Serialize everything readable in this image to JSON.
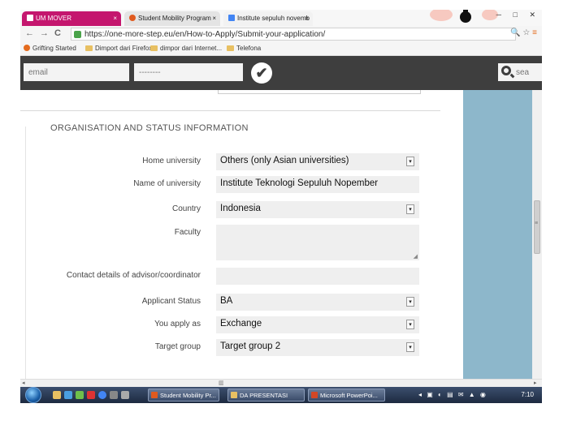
{
  "browser": {
    "tabs": [
      {
        "label": "UM MOVER",
        "favicon_color": "#c4166e"
      },
      {
        "label": "Student Mobility Program",
        "favicon_color": "#e05a1e"
      },
      {
        "label": "Institute sepuluh novemb",
        "favicon_color": "#4285f4"
      }
    ],
    "tab_close": "×",
    "window_controls": "─ □ ✕",
    "nav": {
      "back": "←",
      "forward": "→",
      "reload": "C",
      "zoom": "🔍",
      "star": "☆",
      "menu": "≡"
    },
    "url": "https://one-more-step.eu/en/How-to-Apply/Submit-your-application/",
    "bookmarks": [
      {
        "label": "Grifting Started",
        "icon": "firefox-icon"
      },
      {
        "label": "Dimport dari Firefox",
        "icon": "folder-icon"
      },
      {
        "label": "dimpor dari Internet...",
        "icon": "folder-icon"
      },
      {
        "label": "Telefona",
        "icon": "folder-icon"
      }
    ]
  },
  "site_header": {
    "email_placeholder": "email",
    "password_placeholder": "--------",
    "submit_symbol": "✔",
    "search_placeholder": "sea"
  },
  "form": {
    "section_title": "ORGANISATION AND STATUS INFORMATION",
    "fields": [
      {
        "label": "Home university",
        "value": "Others (only Asian universities)",
        "type": "select"
      },
      {
        "label": "Name of university",
        "value": "Institute Teknologi Sepuluh Nopember",
        "type": "text"
      },
      {
        "label": "Country",
        "value": "Indonesia",
        "type": "select"
      },
      {
        "label": "Faculty",
        "value": "",
        "type": "textarea"
      },
      {
        "label": "Contact details of advisor/coordinator",
        "value": "",
        "type": "text"
      },
      {
        "label": "Applicant Status",
        "value": "BA",
        "type": "select"
      },
      {
        "label": "You apply as",
        "value": "Exchange",
        "type": "select"
      },
      {
        "label": "Target group",
        "value": "Target group 2",
        "type": "select"
      }
    ],
    "select_arrow": "▾",
    "resize_grip": "◢"
  },
  "scrollbar": {
    "left_arrow": "◂",
    "right_arrow": "▸",
    "grip": "▥",
    "v_grip": "≡"
  },
  "taskbar": {
    "tasks": [
      {
        "label": "Student Mobility Pr...",
        "icon_color": "#e05a1e"
      },
      {
        "label": "DA PRESENTASI",
        "icon_color": "#e8c062"
      },
      {
        "label": "Microsoft PowerPoi...",
        "icon_color": "#d24726"
      }
    ],
    "tray": "◂ ▣ ◐ ▤ ✉ ▲ ◉",
    "clock": "7:10",
    "quick_launch_colors": [
      "#e8c062",
      "#4a9fe0",
      "#6fbf4a",
      "#d33",
      "#4285f4",
      "#888"
    ]
  },
  "colors": {
    "accent_tab": "#c4166e",
    "header_bg": "#3e3e3e",
    "side_panel": "#8db7cb",
    "field_bg": "#efefef"
  }
}
